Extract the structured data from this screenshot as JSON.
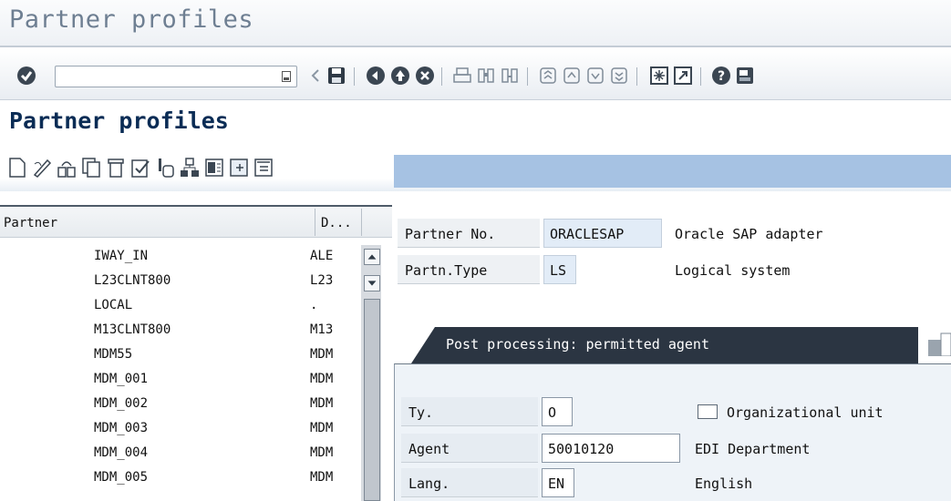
{
  "window": {
    "title": "Partner profiles"
  },
  "toolbar": {
    "command_field_value": "",
    "icons": [
      "enter-icon",
      "save-icon",
      "back-icon",
      "exit-icon",
      "cancel-icon",
      "print-icon",
      "find-icon",
      "find-next-icon",
      "first-page-icon",
      "previous-page-icon",
      "next-page-icon",
      "last-page-icon",
      "new-session-icon",
      "shortcut-icon",
      "help-icon",
      "customize-layout-icon"
    ]
  },
  "screen": {
    "title": "Partner profiles"
  },
  "app_toolbar": {
    "icons": [
      "create-icon",
      "change-icon",
      "display-icon",
      "copy-icon",
      "delete-icon",
      "check-icon",
      "where-used-icon",
      "hierarchy-icon",
      "details-icon",
      "expand-icon",
      "collapse-icon"
    ]
  },
  "partner_list": {
    "columns": {
      "partner": "Partner",
      "desc": "D..."
    },
    "rows": [
      {
        "partner": "IWAY_IN",
        "desc": "ALE"
      },
      {
        "partner": "L23CLNT800",
        "desc": "L23"
      },
      {
        "partner": "LOCAL",
        "desc": "."
      },
      {
        "partner": "M13CLNT800",
        "desc": "M13"
      },
      {
        "partner": "MDM55",
        "desc": "MDM"
      },
      {
        "partner": "MDM_001",
        "desc": "MDM"
      },
      {
        "partner": "MDM_002",
        "desc": "MDM"
      },
      {
        "partner": "MDM_003",
        "desc": "MDM"
      },
      {
        "partner": "MDM_004",
        "desc": "MDM"
      },
      {
        "partner": "MDM_005",
        "desc": "MDM"
      }
    ]
  },
  "partner_detail": {
    "partner_no_label": "Partner No.",
    "partner_no_value": "ORACLESAP",
    "partner_no_desc": "Oracle SAP adapter",
    "partn_type_label": "Partn.Type",
    "partn_type_value": "LS",
    "partn_type_desc": "Logical system"
  },
  "post_processing": {
    "tab_label": "Post processing: permitted agent",
    "ty_label": "Ty.",
    "ty_value": "O",
    "org_unit_label": "Organizational unit",
    "agent_label": "Agent",
    "agent_value": "50010120",
    "agent_desc": "EDI Department",
    "lang_label": "Lang.",
    "lang_value": "EN",
    "lang_desc": "English"
  },
  "colors": {
    "title_blue": "#0a2c55",
    "toolbar_blue": "#a6c2e3",
    "tab_dark": "#2b3542"
  }
}
